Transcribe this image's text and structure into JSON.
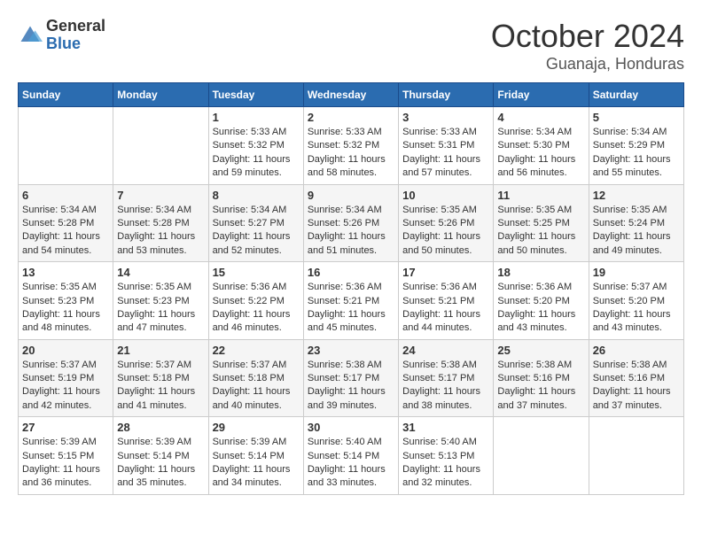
{
  "header": {
    "logo_general": "General",
    "logo_blue": "Blue",
    "month": "October 2024",
    "location": "Guanaja, Honduras"
  },
  "days_of_week": [
    "Sunday",
    "Monday",
    "Tuesday",
    "Wednesday",
    "Thursday",
    "Friday",
    "Saturday"
  ],
  "weeks": [
    [
      {
        "day": "",
        "info": ""
      },
      {
        "day": "",
        "info": ""
      },
      {
        "day": "1",
        "info": "Sunrise: 5:33 AM\nSunset: 5:32 PM\nDaylight: 11 hours and 59 minutes."
      },
      {
        "day": "2",
        "info": "Sunrise: 5:33 AM\nSunset: 5:32 PM\nDaylight: 11 hours and 58 minutes."
      },
      {
        "day": "3",
        "info": "Sunrise: 5:33 AM\nSunset: 5:31 PM\nDaylight: 11 hours and 57 minutes."
      },
      {
        "day": "4",
        "info": "Sunrise: 5:34 AM\nSunset: 5:30 PM\nDaylight: 11 hours and 56 minutes."
      },
      {
        "day": "5",
        "info": "Sunrise: 5:34 AM\nSunset: 5:29 PM\nDaylight: 11 hours and 55 minutes."
      }
    ],
    [
      {
        "day": "6",
        "info": "Sunrise: 5:34 AM\nSunset: 5:28 PM\nDaylight: 11 hours and 54 minutes."
      },
      {
        "day": "7",
        "info": "Sunrise: 5:34 AM\nSunset: 5:28 PM\nDaylight: 11 hours and 53 minutes."
      },
      {
        "day": "8",
        "info": "Sunrise: 5:34 AM\nSunset: 5:27 PM\nDaylight: 11 hours and 52 minutes."
      },
      {
        "day": "9",
        "info": "Sunrise: 5:34 AM\nSunset: 5:26 PM\nDaylight: 11 hours and 51 minutes."
      },
      {
        "day": "10",
        "info": "Sunrise: 5:35 AM\nSunset: 5:26 PM\nDaylight: 11 hours and 50 minutes."
      },
      {
        "day": "11",
        "info": "Sunrise: 5:35 AM\nSunset: 5:25 PM\nDaylight: 11 hours and 50 minutes."
      },
      {
        "day": "12",
        "info": "Sunrise: 5:35 AM\nSunset: 5:24 PM\nDaylight: 11 hours and 49 minutes."
      }
    ],
    [
      {
        "day": "13",
        "info": "Sunrise: 5:35 AM\nSunset: 5:23 PM\nDaylight: 11 hours and 48 minutes."
      },
      {
        "day": "14",
        "info": "Sunrise: 5:35 AM\nSunset: 5:23 PM\nDaylight: 11 hours and 47 minutes."
      },
      {
        "day": "15",
        "info": "Sunrise: 5:36 AM\nSunset: 5:22 PM\nDaylight: 11 hours and 46 minutes."
      },
      {
        "day": "16",
        "info": "Sunrise: 5:36 AM\nSunset: 5:21 PM\nDaylight: 11 hours and 45 minutes."
      },
      {
        "day": "17",
        "info": "Sunrise: 5:36 AM\nSunset: 5:21 PM\nDaylight: 11 hours and 44 minutes."
      },
      {
        "day": "18",
        "info": "Sunrise: 5:36 AM\nSunset: 5:20 PM\nDaylight: 11 hours and 43 minutes."
      },
      {
        "day": "19",
        "info": "Sunrise: 5:37 AM\nSunset: 5:20 PM\nDaylight: 11 hours and 43 minutes."
      }
    ],
    [
      {
        "day": "20",
        "info": "Sunrise: 5:37 AM\nSunset: 5:19 PM\nDaylight: 11 hours and 42 minutes."
      },
      {
        "day": "21",
        "info": "Sunrise: 5:37 AM\nSunset: 5:18 PM\nDaylight: 11 hours and 41 minutes."
      },
      {
        "day": "22",
        "info": "Sunrise: 5:37 AM\nSunset: 5:18 PM\nDaylight: 11 hours and 40 minutes."
      },
      {
        "day": "23",
        "info": "Sunrise: 5:38 AM\nSunset: 5:17 PM\nDaylight: 11 hours and 39 minutes."
      },
      {
        "day": "24",
        "info": "Sunrise: 5:38 AM\nSunset: 5:17 PM\nDaylight: 11 hours and 38 minutes."
      },
      {
        "day": "25",
        "info": "Sunrise: 5:38 AM\nSunset: 5:16 PM\nDaylight: 11 hours and 37 minutes."
      },
      {
        "day": "26",
        "info": "Sunrise: 5:38 AM\nSunset: 5:16 PM\nDaylight: 11 hours and 37 minutes."
      }
    ],
    [
      {
        "day": "27",
        "info": "Sunrise: 5:39 AM\nSunset: 5:15 PM\nDaylight: 11 hours and 36 minutes."
      },
      {
        "day": "28",
        "info": "Sunrise: 5:39 AM\nSunset: 5:14 PM\nDaylight: 11 hours and 35 minutes."
      },
      {
        "day": "29",
        "info": "Sunrise: 5:39 AM\nSunset: 5:14 PM\nDaylight: 11 hours and 34 minutes."
      },
      {
        "day": "30",
        "info": "Sunrise: 5:40 AM\nSunset: 5:14 PM\nDaylight: 11 hours and 33 minutes."
      },
      {
        "day": "31",
        "info": "Sunrise: 5:40 AM\nSunset: 5:13 PM\nDaylight: 11 hours and 32 minutes."
      },
      {
        "day": "",
        "info": ""
      },
      {
        "day": "",
        "info": ""
      }
    ]
  ]
}
